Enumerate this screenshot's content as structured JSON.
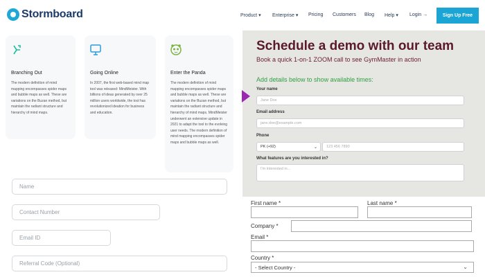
{
  "nav": {
    "logo_text": "Stormboard",
    "items": [
      {
        "label": "Product",
        "chevron": "▾"
      },
      {
        "label": "Enterprise",
        "chevron": "▾"
      },
      {
        "label": "Pricing"
      },
      {
        "label": "Customers"
      },
      {
        "label": "Blog"
      },
      {
        "label": "Help",
        "chevron": "▾"
      },
      {
        "label": "Login →"
      }
    ],
    "signup_label": "Sign Up Free",
    "accent_color": "#1aa5d4"
  },
  "cards": [
    {
      "icon": "branch-icon",
      "title": "Branching Out",
      "text": "The modern definition of mind mapping encompasses spider maps and bubble maps as well. These are variations on the Buzan method, but maintain the radiant structure and hierarchy of mind maps."
    },
    {
      "icon": "monitor-icon",
      "title": "Going Online",
      "text": "In 2007, the first web-based mind map tool was released: MindMeister. With billions of ideas generated by over 25 million users worldwide, the tool has revolutionized ideation for business and education."
    },
    {
      "icon": "panda-icon",
      "title": "Enter the Panda",
      "text": "The modern definition of mind mapping encompasses spider maps and bubble maps as well. These are variations on the Buzan method, but maintain the radiant structure and hierarchy of mind maps. MindMeister underwent an extensive update in 2021 to adapt the tool to the evolving user needs. The modern definition of mind mapping encompasses spider maps and bubble maps as well."
    }
  ],
  "left_form": {
    "name_placeholder": "Name",
    "contact_placeholder": "Contact Number",
    "email_placeholder": "Email ID",
    "referral_placeholder": "Referral Code (Optional)"
  },
  "demo": {
    "title": "Schedule a demo with our team",
    "subtitle": "Book a quick 1-on-1 ZOOM call to see GymMaster in action",
    "add_details": "Add details below to show available times:",
    "name_label": "Your name",
    "name_placeholder": "Jane Doe",
    "email_label": "Email address",
    "email_placeholder": "jane.doe@example.com",
    "phone_label": "Phone",
    "phone_country": "PK (+92)",
    "phone_placeholder": "123 456 7890",
    "features_label": "What features are you interested in?",
    "features_placeholder": "I'm interested in..."
  },
  "bottom_form": {
    "first_name_label": "First name *",
    "last_name_label": "Last name *",
    "company_label": "Company *",
    "email_label": "Email *",
    "country_label": "Country *",
    "country_selected": "- Select Country -"
  }
}
